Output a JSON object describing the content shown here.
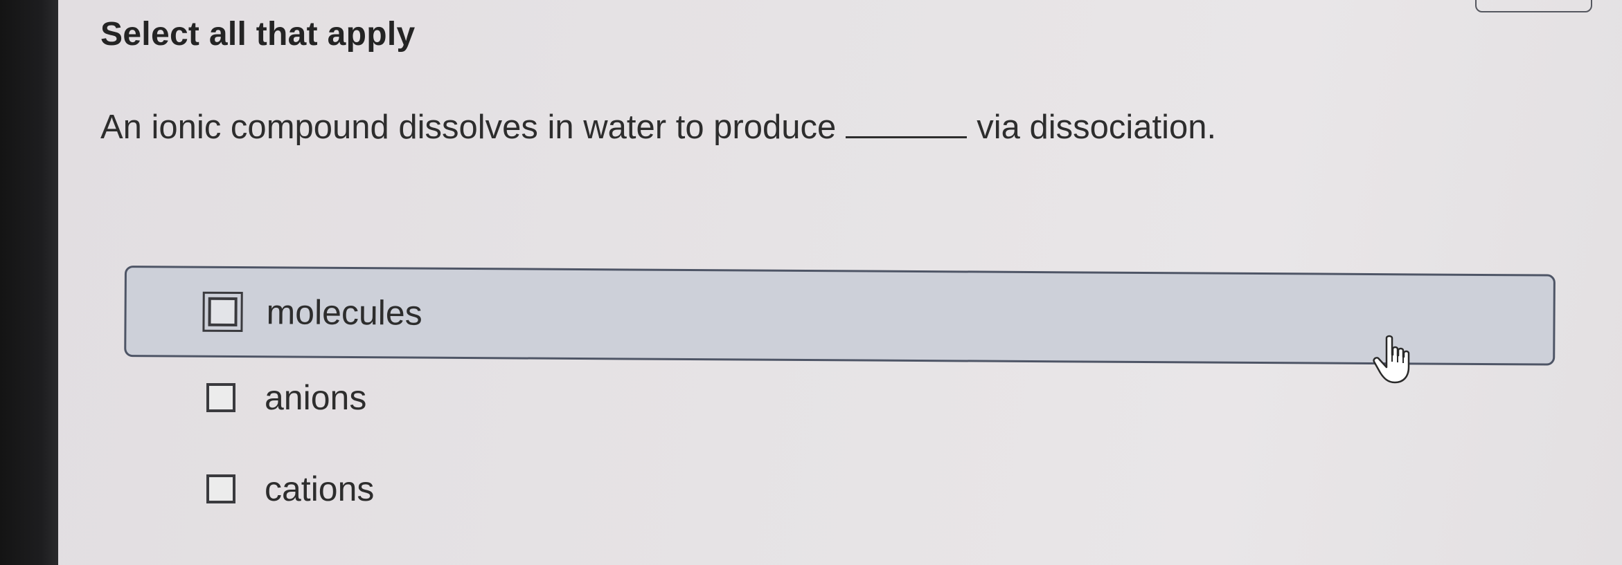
{
  "heading": "Select all that apply",
  "question": {
    "before": "An ionic compound dissolves in water to produce",
    "after": "via dissociation."
  },
  "choices": [
    {
      "label": "molecules",
      "checked": false,
      "highlighted": true
    },
    {
      "label": "anions",
      "checked": false,
      "highlighted": false
    },
    {
      "label": "cations",
      "checked": false,
      "highlighted": false
    }
  ],
  "cursor": {
    "icon": "hand-pointer-icon"
  },
  "colors": {
    "background": "#e6e3e5",
    "highlight": "#cdd0d9",
    "text": "#2d2d2d"
  }
}
